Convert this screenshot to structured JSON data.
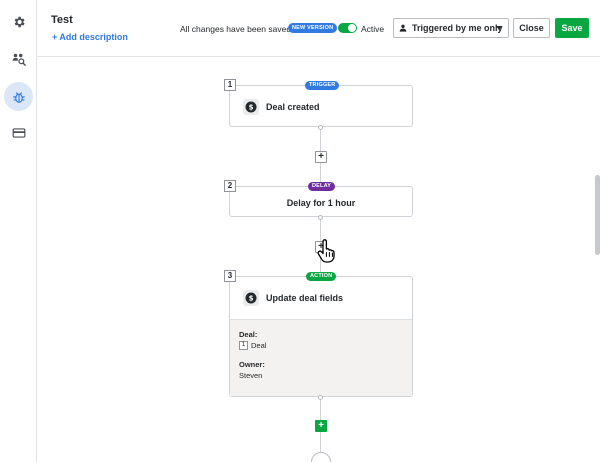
{
  "sidebar": {
    "items": [
      {
        "icon": "gear-icon",
        "active": false
      },
      {
        "icon": "people-search-icon",
        "active": false
      },
      {
        "icon": "bug-icon",
        "active": true
      },
      {
        "icon": "card-icon",
        "active": false
      }
    ]
  },
  "header": {
    "title": "Test",
    "add_description": "+ Add description",
    "saved_status": "All changes have been saved",
    "new_version_badge": "NEW VERSION",
    "active_label": "Active",
    "active": true,
    "trigger_filter": "Triggered by me only",
    "close_label": "Close",
    "save_label": "Save"
  },
  "flow": {
    "steps": [
      {
        "number": "1",
        "tag": "TRIGGER",
        "title": "Deal created",
        "icon": "dollar-icon"
      },
      {
        "number": "2",
        "tag": "DELAY",
        "title": "Delay for 1 hour"
      },
      {
        "number": "3",
        "tag": "ACTION",
        "title": "Update deal fields",
        "icon": "dollar-icon",
        "fields": [
          {
            "label": "Deal:",
            "ref": "1",
            "value": "Deal"
          },
          {
            "label": "Owner:",
            "value": "Steven"
          }
        ]
      }
    ],
    "add_step_symbol": "+"
  },
  "colors": {
    "primary": "#317ae2",
    "success": "#08a742",
    "delay": "#6f2d9f"
  }
}
